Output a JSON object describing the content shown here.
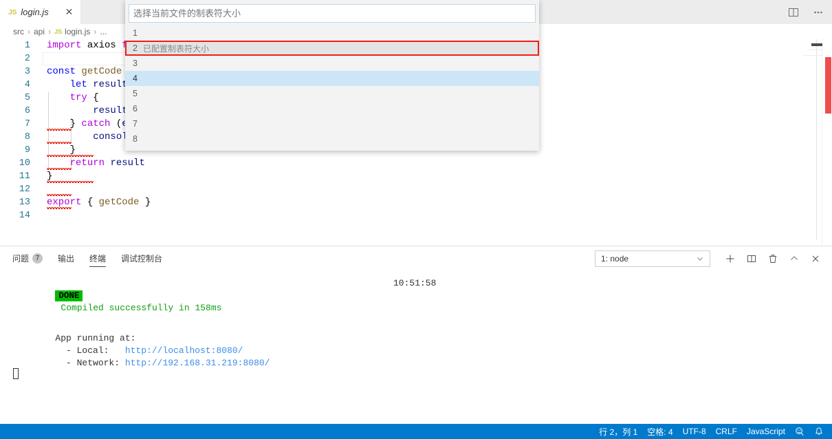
{
  "tab": {
    "file_icon": "JS",
    "label": "login.js",
    "close": "✕"
  },
  "tabbar_actions": {
    "split_editor": "split-editor-icon",
    "more_actions": "···"
  },
  "breadcrumb": {
    "items": [
      "src",
      "api",
      "login.js",
      "..."
    ],
    "file_icon": "JS",
    "separator": "›"
  },
  "editor": {
    "lines": [
      {
        "num": "1",
        "tokens": [
          {
            "t": "import",
            "c": "t-kw"
          },
          {
            "t": " axios ",
            "c": "t-plain"
          },
          {
            "t": "from",
            "c": "t-kw"
          }
        ]
      },
      {
        "num": "2",
        "tokens": []
      },
      {
        "num": "3",
        "tokens": [
          {
            "t": "const",
            "c": "t-var"
          },
          {
            "t": " ",
            "c": "t-plain"
          },
          {
            "t": "getCode",
            "c": "t-fn"
          },
          {
            "t": " = ",
            "c": "t-plain"
          }
        ]
      },
      {
        "num": "4",
        "tokens": [
          {
            "t": "    ",
            "c": "t-plain"
          },
          {
            "t": "let",
            "c": "t-var"
          },
          {
            "t": " ",
            "c": "t-plain"
          },
          {
            "t": "result",
            "c": "t-id"
          }
        ]
      },
      {
        "num": "5",
        "tokens": [
          {
            "t": "    ",
            "c": "t-plain"
          },
          {
            "t": "try",
            "c": "t-kw"
          },
          {
            "t": " {",
            "c": "t-plain"
          }
        ]
      },
      {
        "num": "6",
        "tokens": [
          {
            "t": "        ",
            "c": "t-plain"
          },
          {
            "t": "result",
            "c": "t-id"
          }
        ]
      },
      {
        "num": "7",
        "tokens": [
          {
            "t": "    } ",
            "c": "t-plain"
          },
          {
            "t": "catch",
            "c": "t-kw"
          },
          {
            "t": " (",
            "c": "t-plain"
          },
          {
            "t": "e",
            "c": "t-id"
          },
          {
            "t": ")",
            "c": "t-plain"
          }
        ]
      },
      {
        "num": "8",
        "tokens": [
          {
            "t": "        ",
            "c": "t-plain"
          },
          {
            "t": "console",
            "c": "t-id"
          }
        ]
      },
      {
        "num": "9",
        "tokens": [
          {
            "t": "    }",
            "c": "t-plain"
          }
        ]
      },
      {
        "num": "10",
        "tokens": [
          {
            "t": "    ",
            "c": "t-plain"
          },
          {
            "t": "return",
            "c": "t-kw"
          },
          {
            "t": " ",
            "c": "t-plain"
          },
          {
            "t": "result",
            "c": "t-id"
          }
        ]
      },
      {
        "num": "11",
        "tokens": [
          {
            "t": "}",
            "c": "t-plain"
          }
        ]
      },
      {
        "num": "12",
        "tokens": []
      },
      {
        "num": "13",
        "tokens": [
          {
            "t": "export",
            "c": "t-kw"
          },
          {
            "t": " { ",
            "c": "t-plain"
          },
          {
            "t": "getCode",
            "c": "t-fn"
          },
          {
            "t": " }",
            "c": "t-plain"
          }
        ]
      },
      {
        "num": "14",
        "tokens": []
      }
    ]
  },
  "quickpick": {
    "placeholder": "选择当前文件的制表符大小",
    "input_value": "",
    "items": [
      {
        "label": "1",
        "description": "",
        "state": "normal"
      },
      {
        "label": "2",
        "description": "已配置制表符大小",
        "state": "hovered"
      },
      {
        "label": "3",
        "description": "",
        "state": "normal"
      },
      {
        "label": "4",
        "description": "",
        "state": "selected"
      },
      {
        "label": "5",
        "description": "",
        "state": "normal"
      },
      {
        "label": "6",
        "description": "",
        "state": "normal"
      },
      {
        "label": "7",
        "description": "",
        "state": "normal"
      },
      {
        "label": "8",
        "description": "",
        "state": "normal"
      }
    ],
    "highlight_color": "#f21b1b"
  },
  "panel": {
    "tabs": [
      {
        "label": "问题",
        "badge": "7",
        "active": false
      },
      {
        "label": "输出",
        "badge": "",
        "active": false
      },
      {
        "label": "终端",
        "badge": "",
        "active": true
      },
      {
        "label": "调试控制台",
        "badge": "",
        "active": false
      }
    ],
    "terminal_select": "1: node",
    "actions": {
      "new_terminal": "+",
      "split_terminal": "split-icon",
      "kill_terminal": "trash-icon",
      "maximize_panel": "chevron-up-icon",
      "close_panel": "✕"
    },
    "terminal_output": {
      "done_badge": "DONE",
      "compiled_message": "Compiled successfully in 158ms",
      "timestamp": "10:51:58",
      "app_running_label": "App running at:",
      "local_label": "  - Local:   ",
      "local_url": "http://localhost:8080/",
      "network_label": "  - Network: ",
      "network_url": "http://192.168.31.219:8080/"
    }
  },
  "statusbar": {
    "items": [
      {
        "name": "cursor-position",
        "label": "行 2，列 1"
      },
      {
        "name": "indentation",
        "label": "空格: 4"
      },
      {
        "name": "encoding",
        "label": "UTF-8"
      },
      {
        "name": "eol",
        "label": "CRLF"
      },
      {
        "name": "language-mode",
        "label": "JavaScript"
      }
    ],
    "feedback_icon": "smiley-icon",
    "bell_icon": "🔔",
    "background": "#007acc"
  }
}
